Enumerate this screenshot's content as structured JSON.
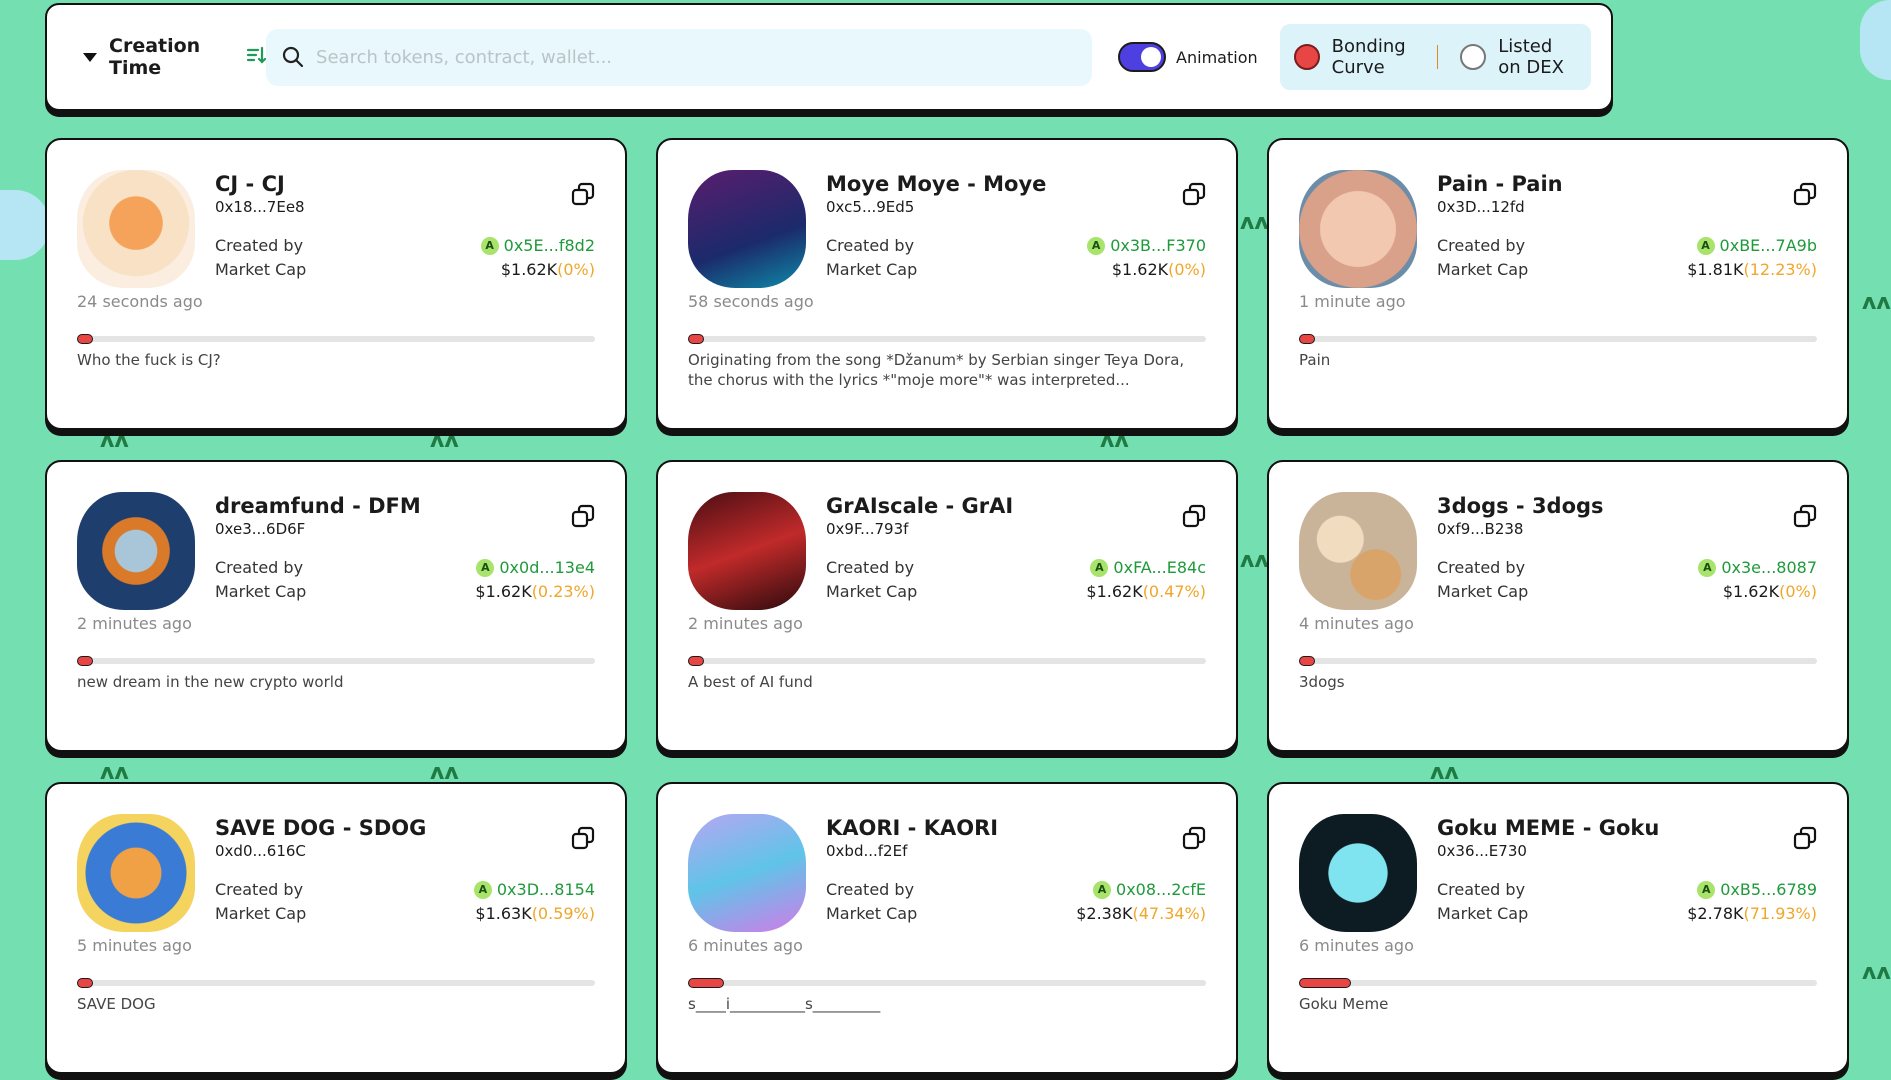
{
  "toolbar": {
    "sort_label": "Creation Time",
    "search_placeholder": "Search tokens, contract, wallet...",
    "animation_label": "Animation",
    "animation_on": true,
    "filter_bonding": "Bonding Curve",
    "filter_dex": "Listed on DEX"
  },
  "labels": {
    "created_by": "Created by",
    "market_cap": "Market Cap"
  },
  "colors": {
    "background": "#74e0b2",
    "accent_green": "#1f9a3a",
    "percent": "#f0a62a",
    "progress": "#e84545",
    "toggle": "#4d3fe0"
  },
  "tokens": [
    {
      "title": "CJ - CJ",
      "address": "0x18...7Ee8",
      "creator": "0x5E...f8d2",
      "mcap": "$1.62K",
      "pct": "(0%)",
      "ago": "24 seconds ago",
      "progress": 0.01,
      "desc": "Who the fuck is CJ?"
    },
    {
      "title": "Moye Moye - Moye",
      "address": "0xc5...9Ed5",
      "creator": "0x3B...F370",
      "mcap": "$1.62K",
      "pct": "(0%)",
      "ago": "58 seconds ago",
      "progress": 0.01,
      "desc": "Originating from the song *Džanum* by Serbian singer Teya Dora, the chorus with the lyrics *\"moje more\"* was interpreted..."
    },
    {
      "title": "Pain - Pain",
      "address": "0x3D...12fd",
      "creator": "0xBE...7A9b",
      "mcap": "$1.81K",
      "pct": "(12.23%)",
      "ago": "1 minute ago",
      "progress": 0.02,
      "desc": "Pain"
    },
    {
      "title": "dreamfund - DFM",
      "address": "0xe3...6D6F",
      "creator": "0x0d...13e4",
      "mcap": "$1.62K",
      "pct": "(0.23%)",
      "ago": "2 minutes ago",
      "progress": 0.01,
      "desc": "new dream in the new crypto world"
    },
    {
      "title": "GrAIscale - GrAI",
      "address": "0x9F...793f",
      "creator": "0xFA...E84c",
      "mcap": "$1.62K",
      "pct": "(0.47%)",
      "ago": "2 minutes ago",
      "progress": 0.01,
      "desc": "A best of AI fund"
    },
    {
      "title": "3dogs - 3dogs",
      "address": "0xf9...B238",
      "creator": "0x3e...8087",
      "mcap": "$1.62K",
      "pct": "(0%)",
      "ago": "4 minutes ago",
      "progress": 0.01,
      "desc": "3dogs"
    },
    {
      "title": "SAVE DOG - SDOG",
      "address": "0xd0...616C",
      "creator": "0x3D...8154",
      "mcap": "$1.63K",
      "pct": "(0.59%)",
      "ago": "5 minutes ago",
      "progress": 0.01,
      "desc": "SAVE DOG"
    },
    {
      "title": "KAORI - KAORI",
      "address": "0xbd...f2Ef",
      "creator": "0x08...2cfE",
      "mcap": "$2.38K",
      "pct": "(47.34%)",
      "ago": "6 minutes ago",
      "progress": 0.07,
      "desc": "s____i__________s_________"
    },
    {
      "title": "Goku MEME - Goku",
      "address": "0x36...E730",
      "creator": "0xB5...6789",
      "mcap": "$2.78K",
      "pct": "(71.93%)",
      "ago": "6 minutes ago",
      "progress": 0.1,
      "desc": "Goku Meme"
    }
  ]
}
